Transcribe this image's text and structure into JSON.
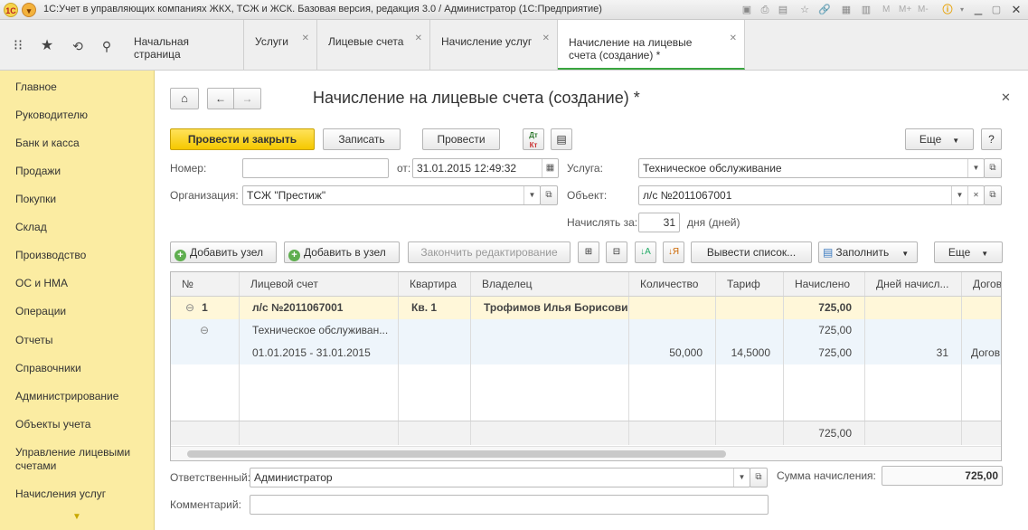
{
  "window": {
    "title": "1С:Учет в управляющих компаниях ЖКХ, ТСЖ и ЖСК. Базовая версия, редакция 3.0 / Администратор  (1С:Предприятие)",
    "mem_buttons": [
      "M",
      "M+",
      "M-"
    ]
  },
  "tabs": [
    {
      "label": "Начальная страница",
      "closable": false
    },
    {
      "label": "Услуги",
      "closable": true
    },
    {
      "label": "Лицевые счета",
      "closable": true
    },
    {
      "label": "Начисление услуг",
      "closable": true
    },
    {
      "label": "Начисление на лицевые счета (создание) *",
      "closable": true,
      "active": true
    }
  ],
  "sidebar": {
    "items": [
      "Главное",
      "Руководителю",
      "Банк и касса",
      "Продажи",
      "Покупки",
      "Склад",
      "Производство",
      "ОС и НМА",
      "Операции",
      "Отчеты",
      "Справочники",
      "Администрирование",
      "Объекты учета",
      "Управление лицевыми счетами",
      "Начисления услуг"
    ]
  },
  "form": {
    "title": "Начисление на лицевые счета (создание) *",
    "buttons": {
      "post_close": "Провести и закрыть",
      "save": "Записать",
      "post": "Провести",
      "more": "Еще",
      "help": "?"
    },
    "fields": {
      "number_label": "Номер:",
      "number_value": "",
      "date_label": "от:",
      "date_value": "31.01.2015 12:49:32",
      "service_label": "Услуга:",
      "service_value": "Техническое обслуживание",
      "org_label": "Организация:",
      "org_value": "ТСЖ \"Престиж\"",
      "object_label": "Объект:",
      "object_value": "л/с №2011067001",
      "accrue_label": "Начислять за:",
      "accrue_value": "31",
      "accrue_unit": "дня (дней)"
    },
    "table_toolbar": {
      "add_node": "Добавить узел",
      "add_to_node": "Добавить в узел",
      "finish_edit": "Закончить редактирование",
      "list_out": "Вывести список...",
      "fill": "Заполнить",
      "more": "Еще"
    },
    "table": {
      "columns": [
        "№",
        "Лицевой счет",
        "Квартира",
        "Владелец",
        "Количество",
        "Тариф",
        "Начислено",
        "Дней начисл...",
        "Догов"
      ],
      "rows": [
        {
          "n": "1",
          "account": "л/с №2011067001",
          "apartment": "Кв. 1",
          "owner": "Трофимов Илья Борисович",
          "qty": "",
          "tariff": "",
          "accrued": "725,00",
          "days": "",
          "contract": ""
        },
        {
          "n": "",
          "account": "Техническое обслуживан...",
          "apartment": "",
          "owner": "",
          "qty": "",
          "tariff": "",
          "accrued": "725,00",
          "days": "",
          "contract": ""
        },
        {
          "n": "",
          "account": "01.01.2015 - 31.01.2015",
          "apartment": "",
          "owner": "",
          "qty": "50,000",
          "tariff": "14,5000",
          "accrued": "725,00",
          "days": "31",
          "contract": "Догов"
        }
      ],
      "footer_total": "725,00"
    },
    "responsible_label": "Ответственный:",
    "responsible_value": "Администратор",
    "sum_label": "Сумма начисления:",
    "sum_value": "725,00",
    "comment_label": "Комментарий:",
    "comment_value": ""
  }
}
